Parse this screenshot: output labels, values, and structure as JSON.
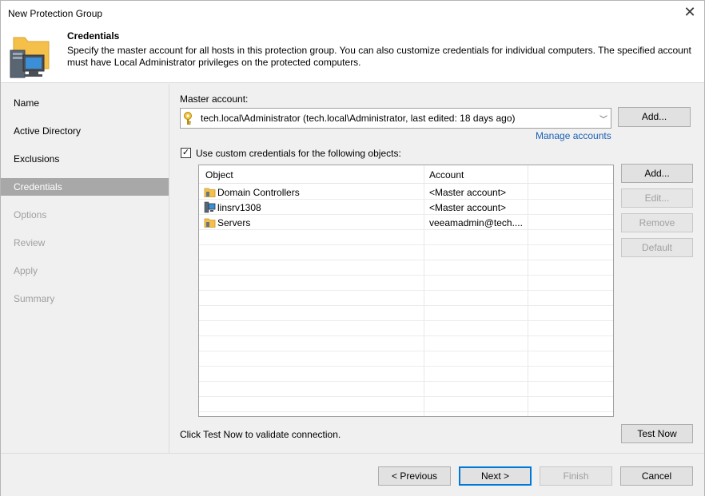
{
  "window": {
    "title": "New Protection Group"
  },
  "header": {
    "title": "Credentials",
    "description": "Specify the master account for all hosts in this protection group. You can also customize credentials for individual computers. The specified account must have Local Administrator privileges on the protected computers."
  },
  "steps": [
    {
      "label": "Name",
      "state": "enabled"
    },
    {
      "label": "Active Directory",
      "state": "enabled"
    },
    {
      "label": "Exclusions",
      "state": "enabled"
    },
    {
      "label": "Credentials",
      "state": "active"
    },
    {
      "label": "Options",
      "state": "disabled"
    },
    {
      "label": "Review",
      "state": "disabled"
    },
    {
      "label": "Apply",
      "state": "disabled"
    },
    {
      "label": "Summary",
      "state": "disabled"
    }
  ],
  "master": {
    "label": "Master account:",
    "value": "tech.local\\Administrator (tech.local\\Administrator, last edited: 18 days ago)",
    "add_label": "Add...",
    "manage_label": "Manage accounts"
  },
  "custom": {
    "checked": true,
    "label": "Use custom credentials for the following objects:"
  },
  "table": {
    "columns": [
      "Object",
      "Account"
    ],
    "rows": [
      {
        "object": "Domain Controllers",
        "account": "<Master account>",
        "icon": "folder-icon"
      },
      {
        "object": "linsrv1308",
        "account": "<Master account>",
        "icon": "server-icon"
      },
      {
        "object": "Servers",
        "account": "veeamadmin@tech....",
        "icon": "folder-icon"
      }
    ]
  },
  "side_buttons": {
    "add": "Add...",
    "edit": "Edit...",
    "remove": "Remove",
    "default": "Default"
  },
  "test": {
    "hint": "Click Test Now to validate connection.",
    "button": "Test Now"
  },
  "footer": {
    "previous": "< Previous",
    "next": "Next >",
    "finish": "Finish",
    "cancel": "Cancel"
  },
  "colors": {
    "active_step": "#a8a8a8",
    "link": "#1a5fb4",
    "primary_border": "#0078d7"
  }
}
